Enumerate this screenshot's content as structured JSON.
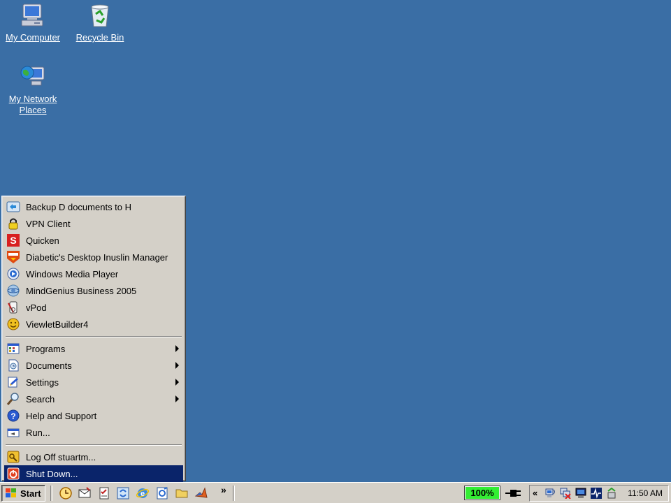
{
  "desktop": {
    "background": "#3a6ea5",
    "icons": [
      {
        "label": "My Computer",
        "icon": "my-computer-icon"
      },
      {
        "label": "Recycle Bin",
        "icon": "recycle-bin-icon"
      },
      {
        "label": "My Network Places",
        "icon": "network-places-icon"
      }
    ]
  },
  "start_menu": {
    "pinned": [
      {
        "label": "Backup D documents to H",
        "icon": "backup-icon"
      },
      {
        "label": "VPN Client",
        "icon": "lock-icon"
      },
      {
        "label": "Quicken",
        "icon": "quicken-icon"
      },
      {
        "label": "Diabetic's Desktop Inuslin Manager",
        "icon": "insulin-manager-icon"
      },
      {
        "label": "Windows Media Player",
        "icon": "media-player-icon"
      },
      {
        "label": "MindGenius Business 2005",
        "icon": "mindgenius-icon"
      },
      {
        "label": "vPod",
        "icon": "vpod-icon"
      },
      {
        "label": "ViewletBuilder4",
        "icon": "viewletbuilder-icon"
      }
    ],
    "system": [
      {
        "label": "Programs",
        "icon": "programs-icon",
        "submenu": true
      },
      {
        "label": "Documents",
        "icon": "documents-icon",
        "submenu": true
      },
      {
        "label": "Settings",
        "icon": "settings-icon",
        "submenu": true
      },
      {
        "label": "Search",
        "icon": "search-icon",
        "submenu": true
      },
      {
        "label": "Help and Support",
        "icon": "help-icon",
        "submenu": false
      },
      {
        "label": "Run...",
        "icon": "run-icon",
        "submenu": false
      }
    ],
    "session": [
      {
        "label": "Log Off stuartm...",
        "icon": "logoff-icon"
      },
      {
        "label": "Shut Down...",
        "icon": "shutdown-icon",
        "selected": true
      }
    ],
    "selected_color": "#0a246a"
  },
  "taskbar": {
    "start_label": "Start",
    "quick_launch": [
      "clock-icon",
      "mail-icon",
      "task-icon",
      "sync-icon",
      "internet-explorer-icon",
      "script-icon",
      "folder-icon",
      "matlab-icon"
    ],
    "more_label": "»",
    "battery": {
      "label": "100%",
      "level": 1.0,
      "color": "#33ee33"
    },
    "tray": {
      "chevron": "«",
      "icons": [
        "network-icon",
        "network-disconnected-icon",
        "display-icon",
        "activity-monitor-icon",
        "recycle-tray-icon"
      ]
    },
    "clock": "11:50 AM"
  }
}
